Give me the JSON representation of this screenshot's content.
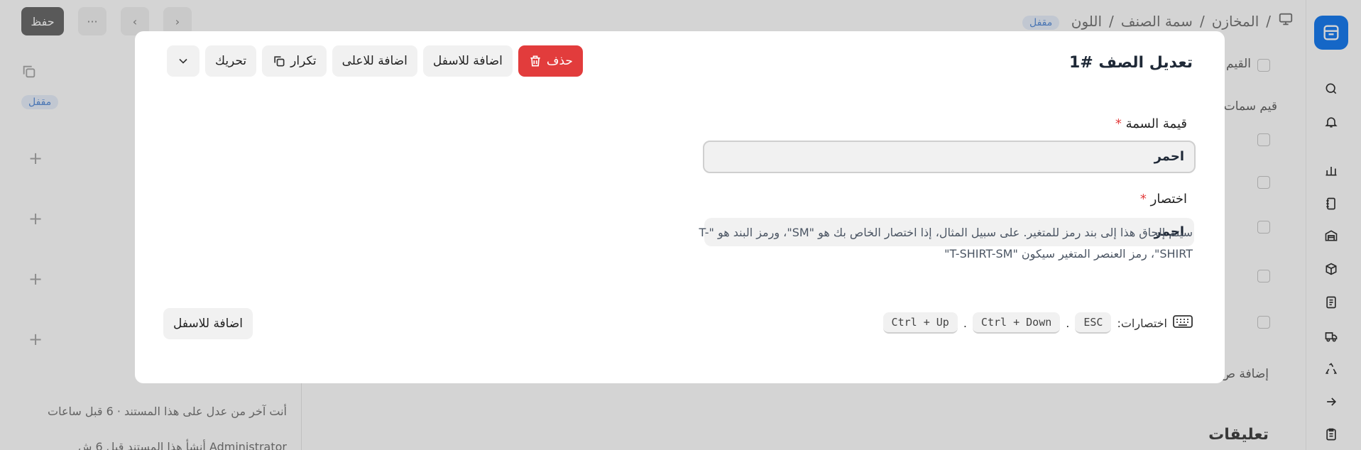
{
  "breadcrumb": {
    "items": [
      "المخازن",
      "سمة الصنف",
      "اللون"
    ],
    "separator": "/"
  },
  "status": {
    "locked_label": "مقفل"
  },
  "toolbar": {
    "save_label": "حفظ",
    "more_label": "···"
  },
  "background": {
    "right_checkbox_label": "القيم",
    "right_section_label": "قيم سمات",
    "add_row_label": "إضافة ص",
    "comments_title": "تعليقات",
    "last_edit_text": "أنت آخر من عدل على هذا المستند · 6 قبل ساعات",
    "created_text": "Administrator أنشأ هذا المستند قبل 6 ش"
  },
  "modal": {
    "title": "تعديل الصف #1",
    "actions": {
      "delete_label": "حذف",
      "add_below_label": "اضافة للاسفل",
      "add_above_label": "اضافة للاعلى",
      "duplicate_label": "تكرار",
      "move_label": "تحريك"
    },
    "fields": {
      "attribute_value": {
        "label": "قيمة السمة",
        "required_mark": "*",
        "value": "احمر"
      },
      "abbreviation": {
        "label": "اختصار",
        "required_mark": "*",
        "value": "احمر"
      }
    },
    "help_text": "سيتم إلحاق هذا إلى بند رمز للمتغير. على سبيل المثال، إذا اختصار الخاص بك هو \"SM\"، ورمز البند هو \"T-SHIRT\"، رمز العنصر المتغير سيكون \"T-SHIRT-SM\"",
    "shortcuts": {
      "label": "اختصارات:",
      "keys": [
        "ESC",
        "Ctrl + Down",
        "Ctrl + Up"
      ],
      "separator": "."
    },
    "footer_add_below_label": "اضافة للاسفل"
  },
  "colors": {
    "accent": "#1a7cf0",
    "danger": "#e23c3c",
    "overlay": "rgba(0,0,0,0.17)"
  },
  "icons": {
    "rail": [
      "app-logo-icon",
      "search-icon",
      "bell-icon",
      "bar-chart-icon",
      "ledger-icon",
      "warehouse-icon",
      "box-icon",
      "document-icon",
      "truck-icon",
      "recycle-icon",
      "arrow-right-icon",
      "clipboard-icon"
    ]
  }
}
